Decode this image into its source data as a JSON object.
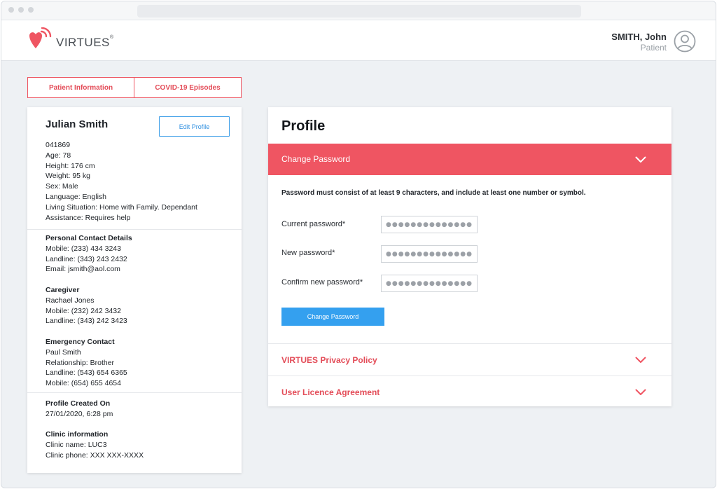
{
  "app": {
    "brand": "VIRTUES",
    "brand_mark": "®"
  },
  "user": {
    "name": "SMITH, John",
    "role": "Patient"
  },
  "tabs": [
    {
      "label": "Patient Information"
    },
    {
      "label": "COVID-19 Episodes"
    }
  ],
  "patient": {
    "name": "Julian Smith",
    "edit_label": "Edit Profile",
    "basic": [
      "041869",
      "Age: 78",
      "Height: 176 cm",
      "Weight: 95 kg",
      "Sex: Male",
      "Language: English",
      "Living Situation: Home with Family. Dependant",
      "Assistance: Requires help"
    ],
    "personal_contact": {
      "heading": "Personal Contact Details",
      "lines": [
        "Mobile: (233) 434 3243",
        "Landline: (343) 243 2432",
        "Email: jsmith@aol.com"
      ]
    },
    "caregiver": {
      "heading": "Caregiver",
      "lines": [
        "Rachael Jones",
        "Mobile: (232) 242 3432",
        "Landline: (343) 242 3423"
      ]
    },
    "emergency": {
      "heading": "Emergency Contact",
      "lines": [
        "Paul Smith",
        "Relationship: Brother",
        "Landline: (543) 654 6365",
        "Mobile: (654) 655 4654"
      ]
    },
    "created": {
      "heading": "Profile Created On",
      "lines": [
        "27/01/2020, 6:28 pm"
      ]
    },
    "clinic": {
      "heading": "Clinic information",
      "lines": [
        "Clinic name: LUC3",
        "Clinic phone: XXX XXX-XXXX"
      ]
    }
  },
  "profile": {
    "title": "Profile",
    "change_password": {
      "header": "Change Password",
      "rule": "Password must consist of at least 9 characters, and include at least one number or symbol.",
      "fields": [
        {
          "label": "Current password*",
          "value": "●●●●●●●●●●●●●●"
        },
        {
          "label": "New password*",
          "value": "●●●●●●●●●●●●●●"
        },
        {
          "label": "Confirm new password*",
          "value": "●●●●●●●●●●●●●●"
        }
      ],
      "button": "Change Password"
    },
    "sections": [
      {
        "label": "VIRTUES Privacy Policy"
      },
      {
        "label": "User Licence Agreement"
      }
    ]
  },
  "colors": {
    "accent": "#ef5562",
    "primary_button": "#34a0ef"
  },
  "icons": {
    "logo": "heart-signal-icon",
    "avatar": "user-circle-icon",
    "chevron": "chevron-down-icon"
  }
}
